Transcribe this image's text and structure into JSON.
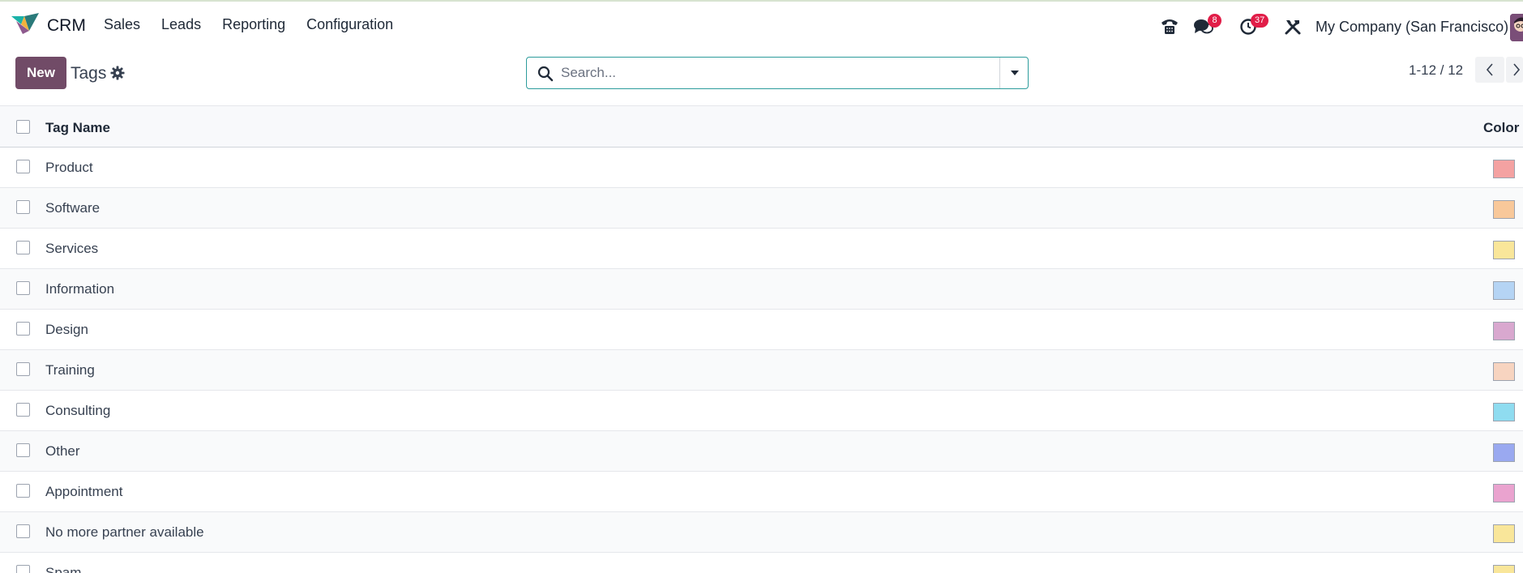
{
  "app": {
    "name": "CRM"
  },
  "menu": [
    "Sales",
    "Leads",
    "Reporting",
    "Configuration"
  ],
  "systray": {
    "messages_count": "8",
    "activities_count": "37",
    "company": "My Company (San Francisco)"
  },
  "control": {
    "new_label": "New",
    "title": "Tags",
    "search_placeholder": "Search...",
    "pager": "1-12 / 12"
  },
  "table": {
    "headers": {
      "name": "Tag Name",
      "color": "Color"
    },
    "rows": [
      {
        "name": "Product",
        "color": "#f4a2a2"
      },
      {
        "name": "Software",
        "color": "#f8c89a"
      },
      {
        "name": "Services",
        "color": "#f9e69a"
      },
      {
        "name": "Information",
        "color": "#b5d4f4"
      },
      {
        "name": "Design",
        "color": "#d9a8cf"
      },
      {
        "name": "Training",
        "color": "#f7d4c0"
      },
      {
        "name": "Consulting",
        "color": "#8fdcf0"
      },
      {
        "name": "Other",
        "color": "#9aa9f0"
      },
      {
        "name": "Appointment",
        "color": "#eaa3cf"
      },
      {
        "name": "No more partner available",
        "color": "#f9e69a"
      },
      {
        "name": "Spam",
        "color": "#f9e69a"
      }
    ]
  }
}
